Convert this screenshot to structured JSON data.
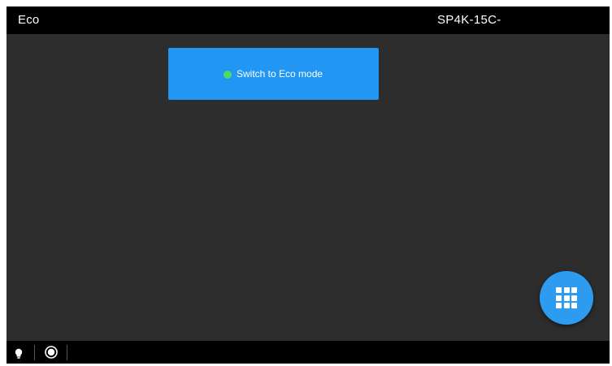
{
  "header": {
    "title": "Eco",
    "device_name": "SP4K-15C-"
  },
  "main": {
    "eco_button": {
      "label": "Switch to Eco mode",
      "status_color": "#4cd964",
      "background_color": "#2196f3"
    }
  },
  "fab": {
    "icon": "apps-grid-icon",
    "color": "#2d9cf0"
  },
  "footer": {
    "icons": [
      "lightbulb-icon",
      "record-icon"
    ]
  },
  "colors": {
    "background": "#2d2d2d",
    "bars": "#000000",
    "accent": "#2196f3"
  }
}
